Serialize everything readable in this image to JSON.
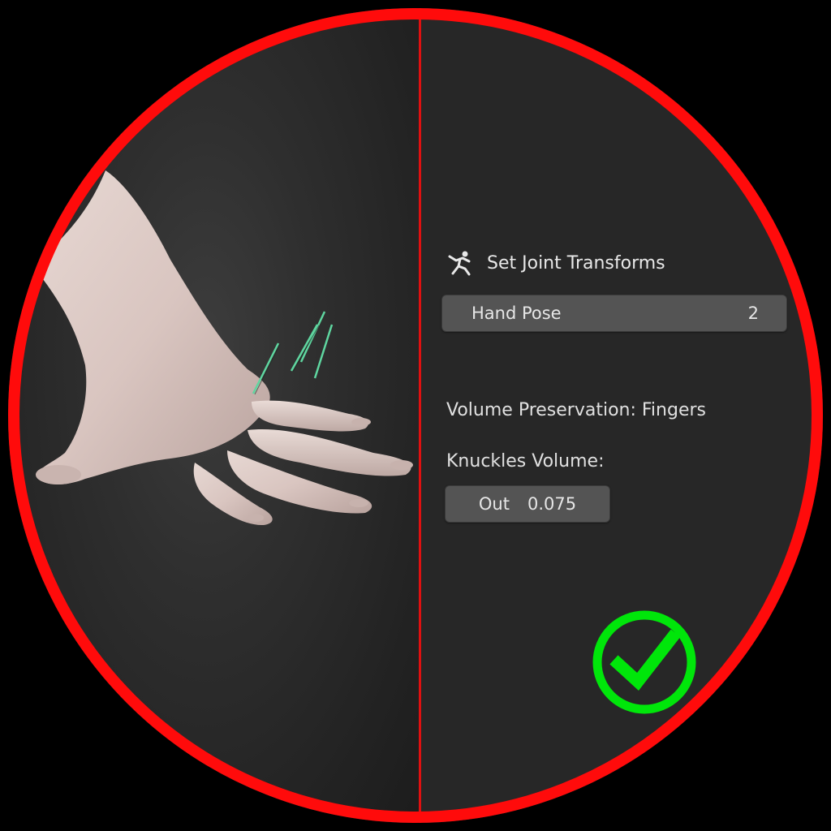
{
  "panel": {
    "title": "Set Joint Transforms",
    "title_icon": "armature-pose-icon",
    "hand_pose": {
      "label": "Hand Pose",
      "value": "2"
    },
    "volume_section_label": "Volume Preservation: Fingers",
    "knuckles_label": "Knuckles Volume:",
    "knuckles_field": {
      "label": "Out",
      "value": "0.075"
    }
  },
  "decorations": {
    "ring_color": "#ff0b0b",
    "divider_color": "#e01010",
    "check_color": "#00e60a",
    "check_icon": "checkmark-icon"
  },
  "viewport": {
    "content": "3d-hand-model",
    "bone_color": "#5fd6a0"
  }
}
